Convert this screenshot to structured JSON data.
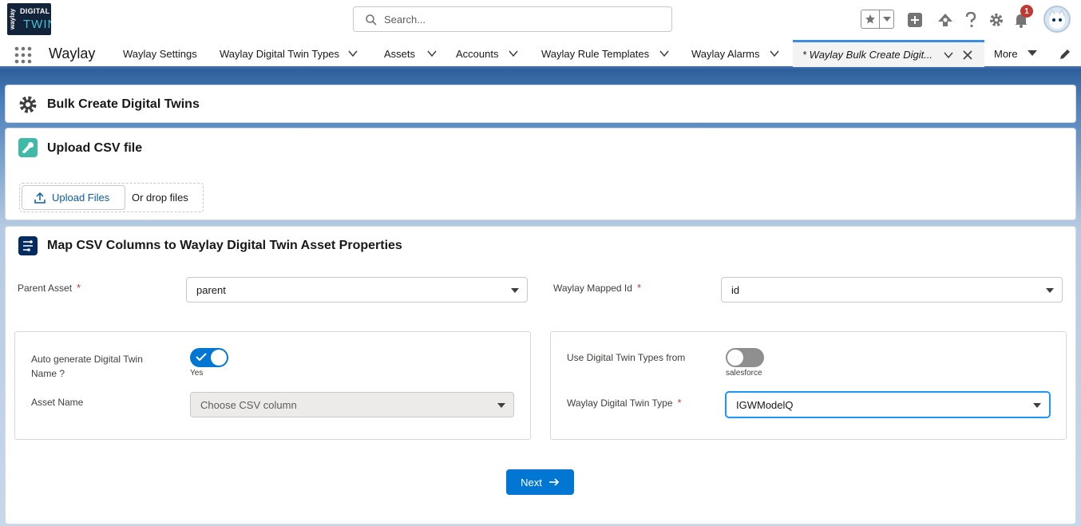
{
  "logo": {
    "top_text": "waylay",
    "mid_text": "DIGITAL",
    "big_text": "TWIN"
  },
  "search": {
    "placeholder": "Search..."
  },
  "notifications": {
    "count": "1"
  },
  "app": {
    "name": "Waylay"
  },
  "nav": {
    "items": [
      {
        "label": "Waylay Settings"
      },
      {
        "label": "Waylay Digital Twin Types"
      },
      {
        "label": "Assets"
      },
      {
        "label": "Accounts"
      },
      {
        "label": "Waylay Rule Templates"
      },
      {
        "label": "Waylay Alarms"
      }
    ],
    "active_tab": "* Waylay Bulk Create Digit...",
    "more": "More"
  },
  "page": {
    "title": "Bulk Create Digital Twins"
  },
  "upload": {
    "title": "Upload CSV file",
    "button": "Upload Files",
    "drop": "Or drop files"
  },
  "map": {
    "title": "Map CSV Columns to Waylay Digital Twin Asset Properties",
    "parent_asset_label": "Parent Asset",
    "parent_asset_value": "parent",
    "mapped_id_label": "Waylay Mapped Id",
    "mapped_id_value": "id",
    "required_mark": "*",
    "auto_gen_label": "Auto generate Digital Twin Name ?",
    "auto_gen_state": "Yes",
    "asset_name_label": "Asset Name",
    "asset_name_value": "Choose CSV column",
    "use_types_label": "Use Digital Twin Types from",
    "use_types_state": "salesforce",
    "twin_type_label": "Waylay Digital Twin Type",
    "twin_type_value": "IGWModelQ",
    "next_button": "Next"
  },
  "colors": {
    "brand_blue": "#0176d3",
    "nav_accent": "#3c6cb0",
    "required": "#c23934"
  }
}
